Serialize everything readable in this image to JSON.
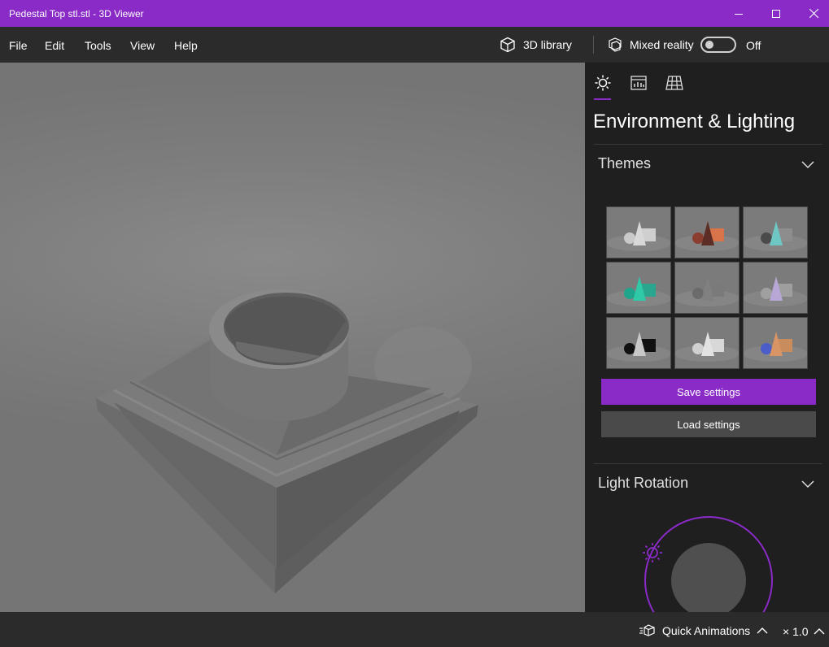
{
  "window": {
    "title": "Pedestal Top stl.stl - 3D Viewer",
    "accent_color": "#8a2bc7"
  },
  "menu": {
    "items": [
      "File",
      "Edit",
      "Tools",
      "View",
      "Help"
    ]
  },
  "toolbar": {
    "library_label": "3D library",
    "mixed_reality_label": "Mixed reality",
    "mixed_reality_state": "Off",
    "mixed_reality_on": false
  },
  "panel": {
    "tabs": [
      {
        "icon": "lighting-icon",
        "selected": true
      },
      {
        "icon": "stats-icon",
        "selected": false
      },
      {
        "icon": "grid-icon",
        "selected": false
      }
    ],
    "title": "Environment & Lighting",
    "themes_section": {
      "label": "Themes",
      "themes": [
        {
          "name": "theme-1",
          "colors": [
            "#c9c9c9",
            "#d8d8d8",
            "#cfcfcf"
          ]
        },
        {
          "name": "theme-2",
          "colors": [
            "#8b3d2f",
            "#5c2d24",
            "#d9744a"
          ]
        },
        {
          "name": "theme-3",
          "colors": [
            "#4b4b4b",
            "#6fc7c4",
            "#8d8d8d"
          ]
        },
        {
          "name": "theme-4",
          "colors": [
            "#1fa58c",
            "#2fc9a8",
            "#2aa58e"
          ]
        },
        {
          "name": "theme-5",
          "colors": [
            "#6b6b6b",
            "#808080",
            "#7a7a7a"
          ]
        },
        {
          "name": "theme-6",
          "colors": [
            "#a0a0a0",
            "#b8a6d6",
            "#9e9e9e"
          ]
        },
        {
          "name": "theme-7",
          "colors": [
            "#101010",
            "#c8c8c8",
            "#111111"
          ]
        },
        {
          "name": "theme-8",
          "colors": [
            "#d0d0d0",
            "#e2e2e2",
            "#d8d8d8"
          ]
        },
        {
          "name": "theme-9",
          "colors": [
            "#4a5dc9",
            "#d99466",
            "#c98c5c"
          ]
        }
      ]
    },
    "save_label": "Save settings",
    "load_label": "Load settings",
    "light_rotation_label": "Light Rotation"
  },
  "statusbar": {
    "animations_label": "Quick Animations",
    "speed_label": "× 1.0"
  }
}
